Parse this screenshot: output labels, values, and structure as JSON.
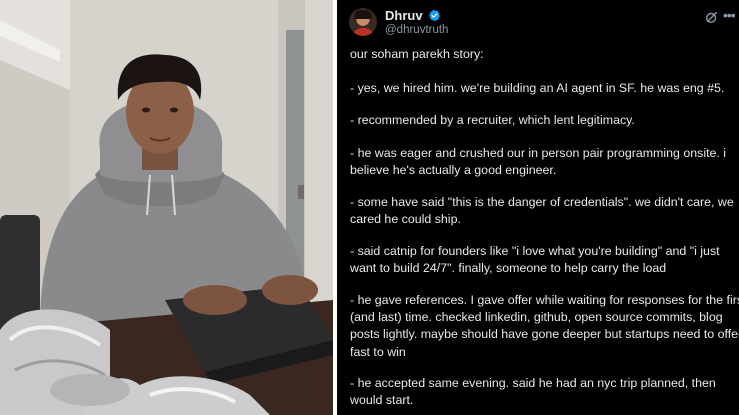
{
  "author": {
    "display_name": "Dhruv",
    "handle": "@dhruvtruth"
  },
  "icons": {
    "verified": "verified-badge-icon",
    "grok": "grok-icon",
    "more": "more-icon"
  },
  "colors": {
    "background": "#000000",
    "text": "#e7e9ea",
    "muted": "#8b98a5",
    "verified": "#1d9bf0"
  },
  "tweet": {
    "paragraphs": [
      {
        "lines": [
          "our soham parekh story:"
        ]
      },
      {
        "lines": [
          "- yes, we hired him. we're building an AI agent in SF. he was eng #5."
        ]
      },
      {
        "lines": [
          "- recommended by a recruiter, which lent legitimacy."
        ]
      },
      {
        "lines": [
          "- he was eager and crushed our in person pair programming onsite. i",
          "believe he's actually a good engineer."
        ]
      },
      {
        "lines": [
          "- some have said \"this is the danger of credentials\". we didn't care, we",
          "cared he could ship."
        ]
      },
      {
        "lines": [
          "- said catnip for founders like \"i love what you're building\" and \"i just",
          "want to build 24/7\". finally, someone to help carry the load"
        ]
      },
      {
        "lines": [
          "- he gave references. I gave offer while waiting for responses for the first",
          "(and last) time. checked linkedin, github, open source commits, blog",
          "posts lightly. maybe should have gone deeper but startups need to offer",
          "fast to win"
        ]
      },
      {
        "lines": [
          "- he accepted same evening. said he had an nyc trip planned, then",
          "would start."
        ]
      }
    ]
  }
}
